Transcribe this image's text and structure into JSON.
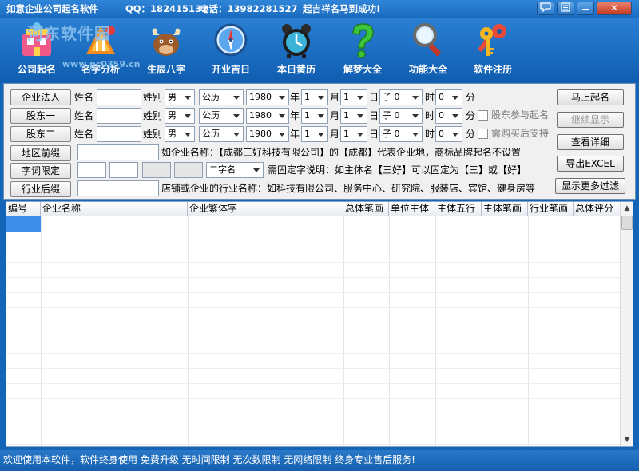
{
  "titlebar": {
    "app_title": "如意企业公司起名软件",
    "qq": "QQ：182415132",
    "phone": "电话：13982281527",
    "slogan": "起吉祥名马到成功!",
    "help_icon": "help-bubble-icon",
    "menu_icon": "menu-icon",
    "minimize_icon": "minimize-icon",
    "close_icon": "close-icon"
  },
  "watermark": {
    "text": "河东软件园",
    "url": "www.pc0359.cn"
  },
  "toolbar": {
    "items": [
      {
        "label": "公司起名",
        "icon": "company-naming-icon"
      },
      {
        "label": "名字分析",
        "icon": "name-analysis-icon"
      },
      {
        "label": "生辰八字",
        "icon": "zodiac-ox-icon"
      },
      {
        "label": "开业吉日",
        "icon": "compass-icon"
      },
      {
        "label": "本日黄历",
        "icon": "alarm-clock-icon"
      },
      {
        "label": "解梦大全",
        "icon": "question-mark-icon"
      },
      {
        "label": "功能大全",
        "icon": "magnifier-icon"
      },
      {
        "label": "软件注册",
        "icon": "keys-icon"
      }
    ]
  },
  "form": {
    "rows": [
      {
        "button": "企业法人",
        "name_label": "姓名",
        "gender_label": "姓别",
        "gender": "男",
        "calendar": "公历",
        "year": "1980",
        "year_unit": "年",
        "month": "1",
        "month_unit": "月",
        "day": "1",
        "day_unit": "日",
        "hour": "子 0",
        "hour_unit": "时",
        "minute": "0",
        "minute_unit": "分"
      },
      {
        "button": "股东一",
        "name_label": "姓名",
        "gender_label": "姓别",
        "gender": "男",
        "calendar": "公历",
        "year": "1980",
        "year_unit": "年",
        "month": "1",
        "month_unit": "月",
        "day": "1",
        "day_unit": "日",
        "hour": "子 0",
        "hour_unit": "时",
        "minute": "0",
        "minute_unit": "分",
        "check_label": "股东参与起名"
      },
      {
        "button": "股东二",
        "name_label": "姓名",
        "gender_label": "姓别",
        "gender": "男",
        "calendar": "公历",
        "year": "1980",
        "year_unit": "年",
        "month": "1",
        "month_unit": "月",
        "day": "1",
        "day_unit": "日",
        "hour": "子 0",
        "hour_unit": "时",
        "minute": "0",
        "minute_unit": "分",
        "check_label": "需购买后支持"
      }
    ],
    "region": {
      "button": "地区前缀",
      "hint": "如企业名称：【成都三好科技有限公司】的【成都】代表企业地，商标品牌起名不设置"
    },
    "word": {
      "button": "字词限定",
      "select": "二字名",
      "hint": "需固定字说明：如主体名【三好】可以固定为【三】或【好】"
    },
    "industry": {
      "button": "行业后缀",
      "hint": "店铺或企业的行业名称：如科技有限公司、服务中心、研究院、服装店、宾馆、健身房等"
    },
    "actions": {
      "start": "马上起名",
      "continue": "继续显示",
      "detail": "查看详细",
      "export": "导出EXCEL",
      "more": "显示更多过滤"
    }
  },
  "table": {
    "columns": [
      "编号",
      "企业名称",
      "企业繁体字",
      "总体笔画",
      "单位主体",
      "主体五行",
      "主体笔画",
      "行业笔画",
      "总体评分"
    ]
  },
  "status": {
    "text": "欢迎使用本软件，软件终身使用 免费升级 无时间限制 无次数限制 无网络限制 终身专业售后服务!"
  }
}
